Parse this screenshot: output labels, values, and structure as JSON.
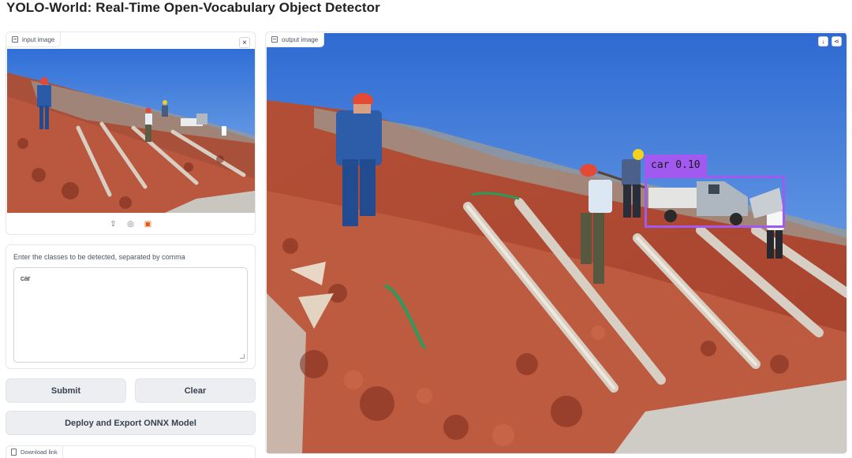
{
  "page": {
    "title": "YOLO-World: Real-Time Open-Vocabulary Object Detector"
  },
  "input_image": {
    "label": "input image",
    "close_symbol": "×",
    "tools": [
      {
        "name": "upload-icon",
        "glyph": "⇪"
      },
      {
        "name": "webcam-icon",
        "glyph": "◎"
      },
      {
        "name": "clipboard-icon",
        "glyph": "▣"
      }
    ]
  },
  "classes": {
    "label": "Enter the classes to be detected, separated by comma",
    "value": "car"
  },
  "buttons": {
    "submit": "Submit",
    "clear": "Clear",
    "deploy": "Deploy and Export ONNX Model"
  },
  "download": {
    "label": "Download link"
  },
  "output_image": {
    "label": "output image",
    "actions": [
      {
        "name": "download-icon",
        "glyph": "↓"
      },
      {
        "name": "share-icon",
        "glyph": "⋖"
      }
    ],
    "detection": {
      "class": "car",
      "score": "0.10",
      "text": "car 0.10",
      "color": "#a259f0"
    }
  },
  "colors": {
    "sky": "#3d7fd9",
    "soil": "#b4533d",
    "box": "#a259f0"
  }
}
